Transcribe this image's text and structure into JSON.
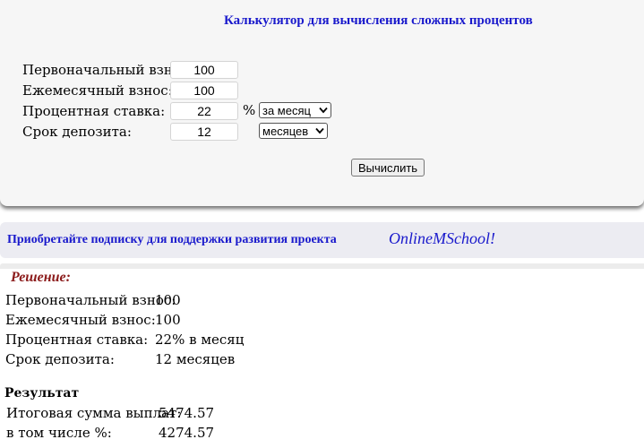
{
  "calculator": {
    "title": "Калькулятор для вычисления сложных процентов",
    "fields": {
      "initial": {
        "label": "Первоначальный взнос:",
        "value": "100"
      },
      "monthly": {
        "label": "Ежемесячный взнос:",
        "value": "100"
      },
      "rate": {
        "label": "Процентная ставка:",
        "value": "22",
        "unit": "%",
        "period_option": "за месяц"
      },
      "term": {
        "label": "Срок депозита:",
        "value": "12",
        "period_option": "месяцев"
      }
    },
    "button_label": "Вычислить"
  },
  "promo": {
    "text": "Приобретайте подписку для поддержки развития проекта",
    "brand": "OnlineMSchool!"
  },
  "solution": {
    "title": "Решение:",
    "rows": [
      {
        "label": "Первоначальный взнос:",
        "value": "100"
      },
      {
        "label": "Ежемесячный взнос:",
        "value": "100"
      },
      {
        "label": "Процентная ставка:",
        "value": "22% в месяц"
      },
      {
        "label": "Срок депозита:",
        "value": "12 месяцев"
      }
    ]
  },
  "result": {
    "title": "Результат",
    "rows": [
      {
        "label": "Итоговая сумма выплат:",
        "value": "5474.57"
      },
      {
        "label": "в том числе %:",
        "value": "4274.57"
      }
    ]
  },
  "colors": {
    "link_blue": "#1a1acc",
    "solution_red": "#8b1a1a",
    "panel_bg": "#f6f6f6"
  }
}
